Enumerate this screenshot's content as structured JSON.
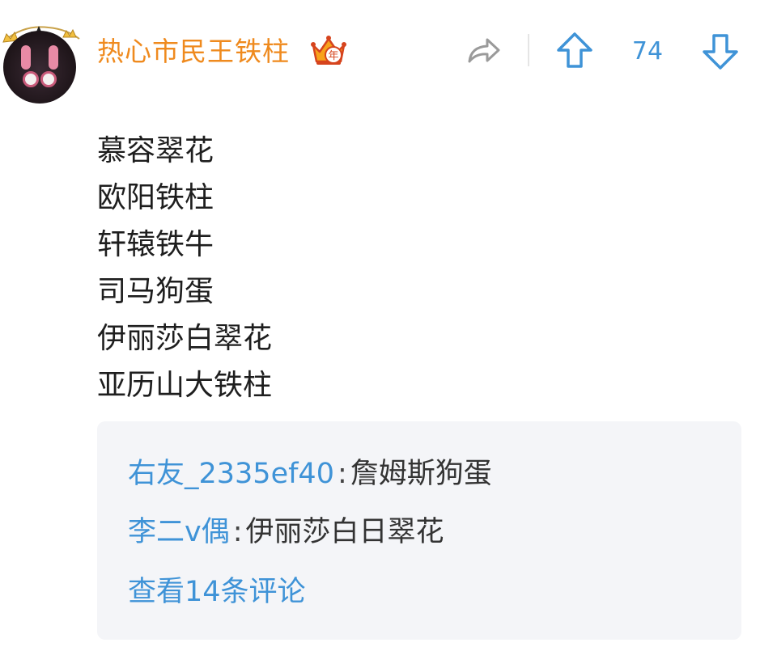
{
  "post": {
    "username": "热心市民王铁柱",
    "vip_badge": "年",
    "vote_count": "74",
    "lines": [
      "慕容翠花",
      "欧阳铁柱",
      "轩辕铁牛",
      "司马狗蛋",
      "伊丽莎白翠花",
      "亚历山大铁柱"
    ]
  },
  "replies": [
    {
      "author": "右友_2335ef40",
      "separator": ":",
      "text": "詹姆斯狗蛋"
    },
    {
      "author": "李二v偶",
      "separator": ":",
      "text": "伊丽莎白日翠花"
    }
  ],
  "view_more": "查看14条评论",
  "icons": {
    "share": "share-icon",
    "upvote": "arrow-up-icon",
    "downvote": "arrow-down-icon"
  },
  "colors": {
    "username": "#ef8a1e",
    "accent": "#3f93d7",
    "reply_bg": "#f4f5f8"
  }
}
